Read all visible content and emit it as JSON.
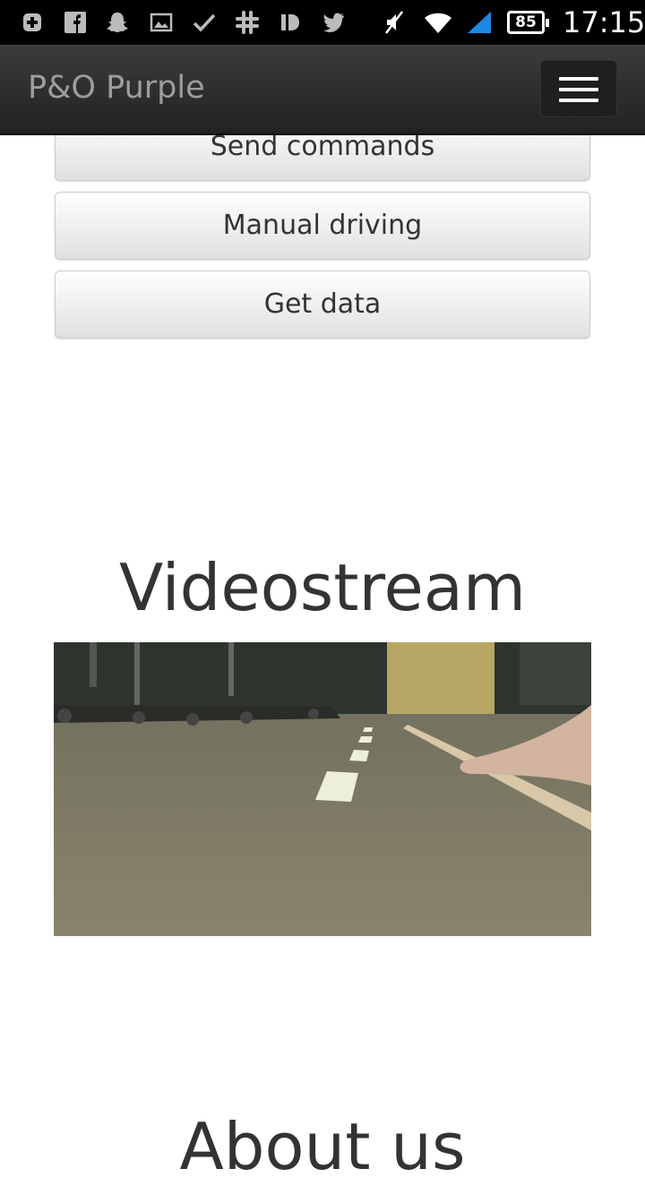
{
  "status_bar": {
    "battery_level": "85",
    "time": "17:15",
    "icons": [
      "plus-square-icon",
      "facebook-icon",
      "snapchat-icon",
      "image-icon",
      "check-icon",
      "slack-icon",
      "deezer-icon",
      "twitter-icon",
      "mute-icon",
      "wifi-icon",
      "signal-icon",
      "battery-icon"
    ]
  },
  "navbar": {
    "brand": "P&O Purple",
    "menu_icon": "hamburger-icon"
  },
  "buttons": {
    "send_commands": "Send commands",
    "manual_driving": "Manual driving",
    "get_data": "Get data"
  },
  "videostream": {
    "title": "Videostream"
  },
  "about": {
    "title": "About us"
  },
  "colors": {
    "navbar_bg": "#222222",
    "brand_text": "#9d9d9d",
    "button_border": "#cccccc"
  }
}
